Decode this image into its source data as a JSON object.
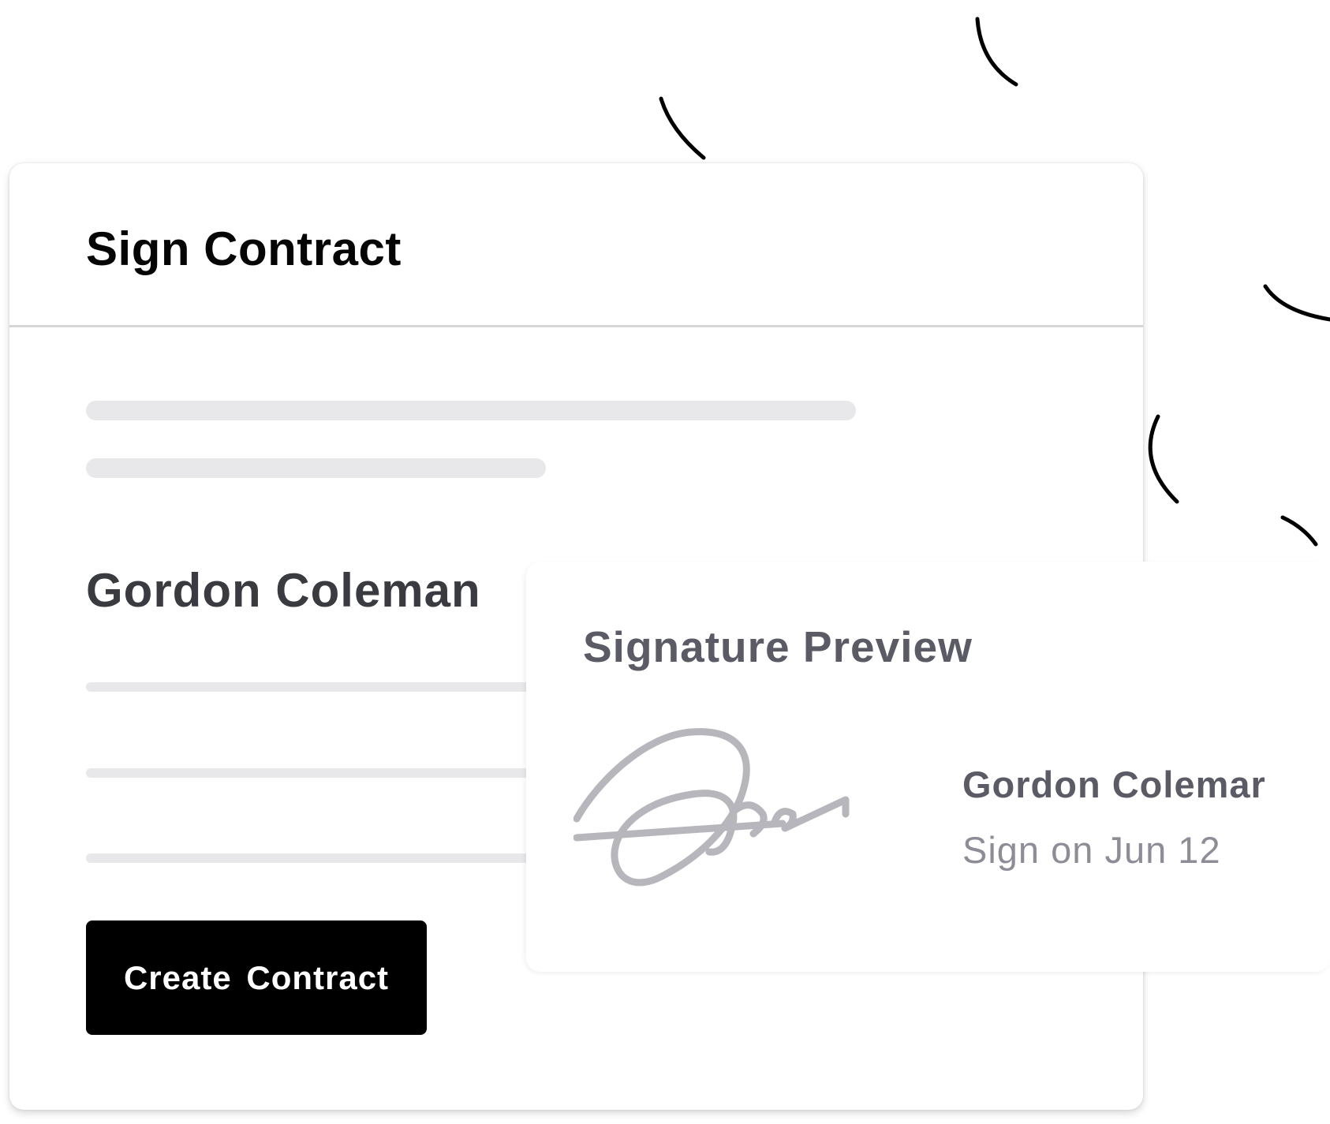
{
  "contract_card": {
    "title": "Sign Contract",
    "signer_name": "Gordon Coleman",
    "create_button_label": "Create  Contract"
  },
  "signature_preview": {
    "title": "Signature Preview",
    "signer_name": "Gordon Colemar",
    "sign_date": "Sign on Jun 12"
  },
  "colors": {
    "button_background": "#000000",
    "button_text": "#ffffff",
    "skeleton_line": "#e8e8ea",
    "signature_stroke": "#b7b6bd",
    "heading_text": "#050505",
    "muted_text": "#5b5b66"
  }
}
